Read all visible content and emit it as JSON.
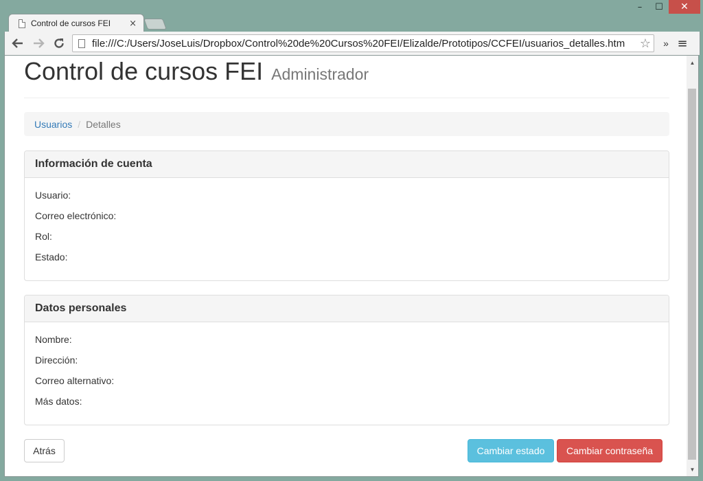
{
  "browser": {
    "tab_title": "Control de cursos FEI",
    "tab_close": "×",
    "url": "file:///C:/Users/JoseLuis/Dropbox/Control%20de%20Cursos%20FEI/Elizalde/Prototipos/CCFEI/usuarios_detalles.htm",
    "extensions_label": "»",
    "window_controls": {
      "minimize": "–",
      "maximize": "☐",
      "close": "✕"
    }
  },
  "header": {
    "title": "Control de cursos FEI",
    "subtitle": "Administrador"
  },
  "breadcrumb": {
    "link": "Usuarios",
    "separator": "/",
    "active": "Detalles"
  },
  "account_panel": {
    "heading": "Información de cuenta",
    "fields": [
      "Usuario:",
      "Correo electrónico:",
      "Rol:",
      "Estado:"
    ]
  },
  "personal_panel": {
    "heading": "Datos personales",
    "fields": [
      "Nombre:",
      "Dirección:",
      "Correo alternativo:",
      "Más datos:"
    ]
  },
  "actions": {
    "back": "Atrás",
    "change_status": "Cambiar estado",
    "change_password": "Cambiar contraseña"
  },
  "colors": {
    "link": "#337ab7",
    "info": "#5bc0de",
    "danger": "#d9534f",
    "window_frame": "#84a99f"
  }
}
